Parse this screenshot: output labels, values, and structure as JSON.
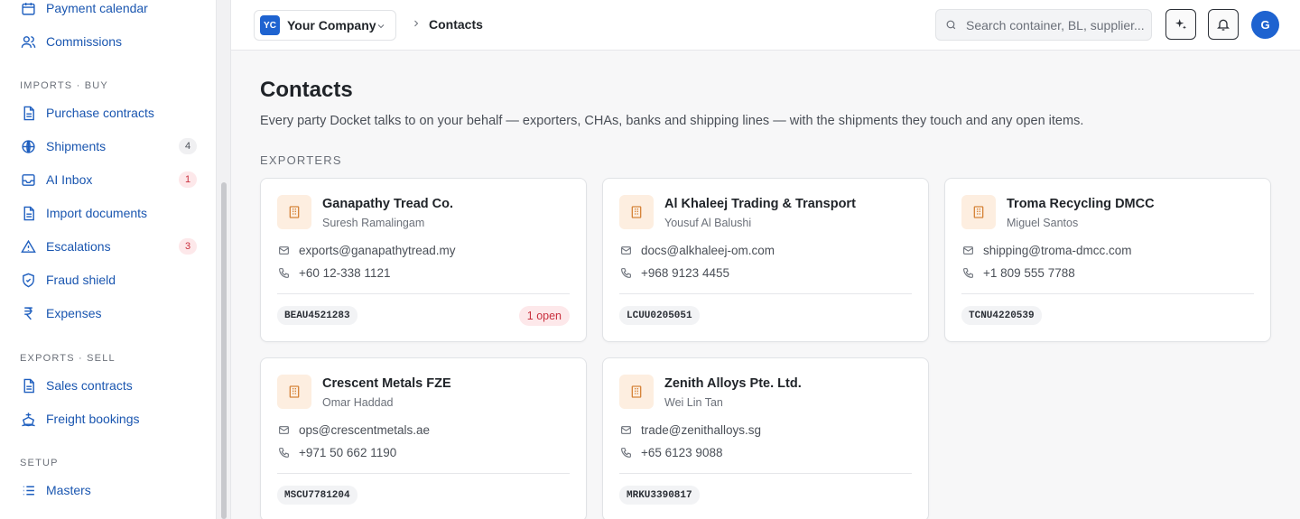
{
  "sidebar": {
    "top_items": [
      {
        "label": "Payment calendar"
      },
      {
        "label": "Commissions"
      }
    ],
    "imports_section": "IMPORTS · BUY",
    "imports_items": [
      {
        "label": "Purchase contracts"
      },
      {
        "label": "Shipments",
        "badge": "4"
      },
      {
        "label": "AI Inbox",
        "badge": "1"
      },
      {
        "label": "Import documents"
      },
      {
        "label": "Escalations",
        "badge": "3"
      },
      {
        "label": "Fraud shield"
      },
      {
        "label": "Expenses"
      }
    ],
    "exports_section": "EXPORTS · SELL",
    "exports_items": [
      {
        "label": "Sales contracts"
      },
      {
        "label": "Freight bookings"
      }
    ],
    "setup_section": "SETUP",
    "setup_items": [
      {
        "label": "Masters"
      }
    ]
  },
  "topbar": {
    "company_initials": "YC",
    "company_name": "Your Company",
    "breadcrumb_current": "Contacts",
    "search_placeholder": "Search container, BL, supplier...",
    "avatar_initial": "G"
  },
  "page": {
    "title": "Contacts",
    "subtitle": "Every party Docket talks to on your behalf — exporters, CHAs, banks and shipping lines — with the shipments they touch and any open items.",
    "group_label": "EXPORTERS"
  },
  "contacts": [
    {
      "name": "Ganapathy Tread Co.",
      "person": "Suresh Ramalingam",
      "email": "exports@ganapathytread.my",
      "phone": "+60 12-338 1121",
      "container": "BEAU4521283",
      "open": "1 open"
    },
    {
      "name": "Al Khaleej Trading & Transport",
      "person": "Yousuf Al Balushi",
      "email": "docs@alkhaleej-om.com",
      "phone": "+968 9123 4455",
      "container": "LCUU0205051"
    },
    {
      "name": "Troma Recycling DMCC",
      "person": "Miguel Santos",
      "email": "shipping@troma-dmcc.com",
      "phone": "+1 809 555 7788",
      "container": "TCNU4220539"
    },
    {
      "name": "Crescent Metals FZE",
      "person": "Omar Haddad",
      "email": "ops@crescentmetals.ae",
      "phone": "+971 50 662 1190",
      "container": "MSCU7781204"
    },
    {
      "name": "Zenith Alloys Pte. Ltd.",
      "person": "Wei Lin Tan",
      "email": "trade@zenithalloys.sg",
      "phone": "+65 6123 9088",
      "container": "MRKU3390817"
    }
  ]
}
